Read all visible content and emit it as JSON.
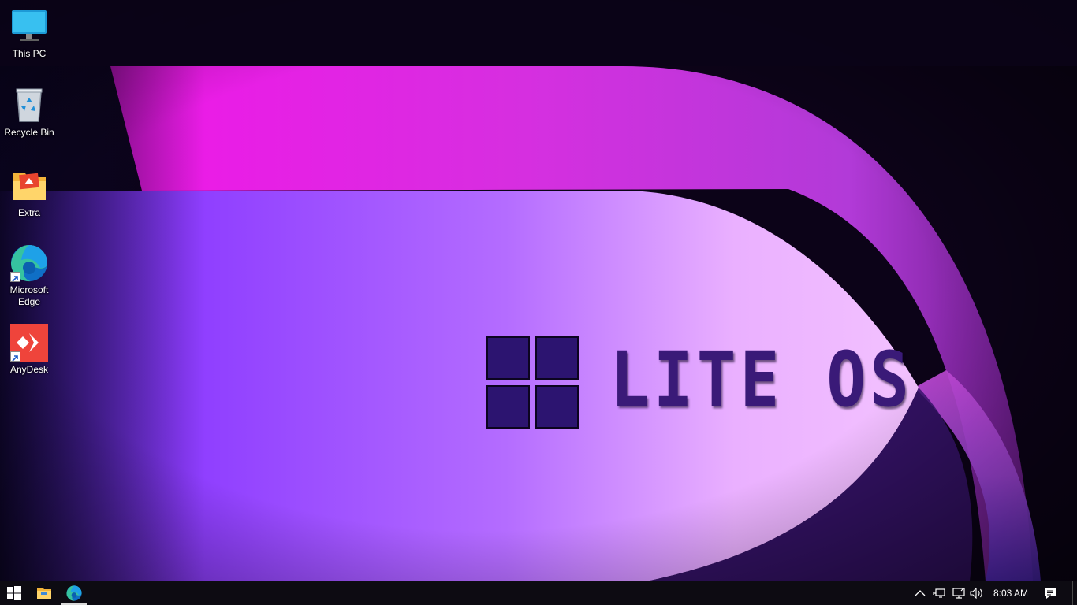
{
  "wallpaper": {
    "brand_text": "LITE OS",
    "colors": {
      "background": "#0a0414",
      "magenta": "#f017e8",
      "violet": "#8b3dff",
      "lavender": "#e8a8ff",
      "text": "#3a1a78",
      "logo_tile": "#2c1470"
    }
  },
  "desktop": {
    "icons": [
      {
        "label": "This PC",
        "icon": "monitor-icon",
        "shortcut": false
      },
      {
        "label": "Recycle Bin",
        "icon": "recycle-bin-icon",
        "shortcut": false
      },
      {
        "label": "Extra",
        "icon": "folder-icon",
        "shortcut": false
      },
      {
        "label": "Microsoft Edge",
        "icon": "edge-icon",
        "shortcut": true
      },
      {
        "label": "AnyDesk",
        "icon": "anydesk-icon",
        "shortcut": true
      }
    ]
  },
  "taskbar": {
    "background": "#0d0b12",
    "pinned": [
      {
        "name": "start",
        "icon": "windows-logo-icon"
      },
      {
        "name": "file-explorer",
        "icon": "folder-icon"
      },
      {
        "name": "microsoft-edge",
        "icon": "edge-icon",
        "active": true
      }
    ],
    "tray": {
      "icons": [
        "chevron-up-icon",
        "network-adapter-icon",
        "network-icon",
        "speaker-icon"
      ],
      "clock": "8:03 AM",
      "notification_icon": "action-center-icon"
    }
  }
}
